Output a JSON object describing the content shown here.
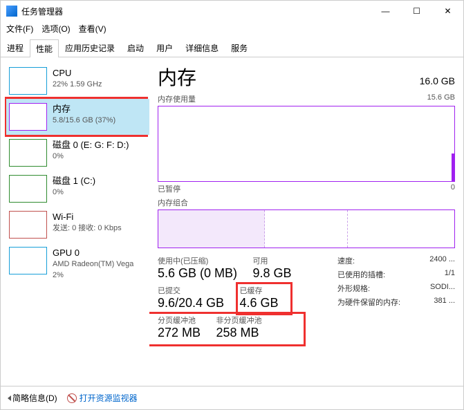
{
  "title": "任务管理器",
  "win_controls": {
    "min": "—",
    "max": "☐",
    "close": "✕"
  },
  "menu": {
    "file": "文件(F)",
    "options": "选项(O)",
    "view": "查看(V)"
  },
  "tabs": [
    "进程",
    "性能",
    "应用历史记录",
    "启动",
    "用户",
    "详细信息",
    "服务"
  ],
  "sidebar": [
    {
      "name": "CPU",
      "sub": "22% 1.59 GHz"
    },
    {
      "name": "内存",
      "sub": "5.8/15.6 GB (37%)"
    },
    {
      "name": "磁盘 0 (E: G: F: D:)",
      "sub": "0%"
    },
    {
      "name": "磁盘 1 (C:)",
      "sub": "0%"
    },
    {
      "name": "Wi-Fi",
      "sub": "发送: 0 接收: 0 Kbps"
    },
    {
      "name": "GPU 0",
      "sub": "AMD Radeon(TM) Vega",
      "sub2": "2%"
    }
  ],
  "pane": {
    "title": "内存",
    "capacity": "16.0 GB",
    "usage_label": "内存使用量",
    "usage_max": "15.6 GB",
    "paused": "已暂停",
    "zero": "0",
    "comp_label": "内存组合",
    "stats": {
      "inuse_lbl": "使用中(已压缩)",
      "inuse_val": "5.6 GB (0 MB)",
      "avail_lbl": "可用",
      "avail_val": "9.8 GB",
      "commit_lbl": "已提交",
      "commit_val": "9.6/20.4 GB",
      "cached_lbl": "已缓存",
      "cached_val": "4.6 GB",
      "paged_lbl": "分页缓冲池",
      "paged_val": "272 MB",
      "nonpaged_lbl": "非分页缓冲池",
      "nonpaged_val": "258 MB"
    },
    "right": {
      "speed_lbl": "速度:",
      "speed_val": "2400 ...",
      "slots_lbl": "已使用的插槽:",
      "slots_val": "1/1",
      "form_lbl": "外形规格:",
      "form_val": "SODI...",
      "hw_lbl": "为硬件保留的内存:",
      "hw_val": "381 ..."
    }
  },
  "footer": {
    "brief": "简略信息(D)",
    "resmon": "打开资源监视器"
  }
}
